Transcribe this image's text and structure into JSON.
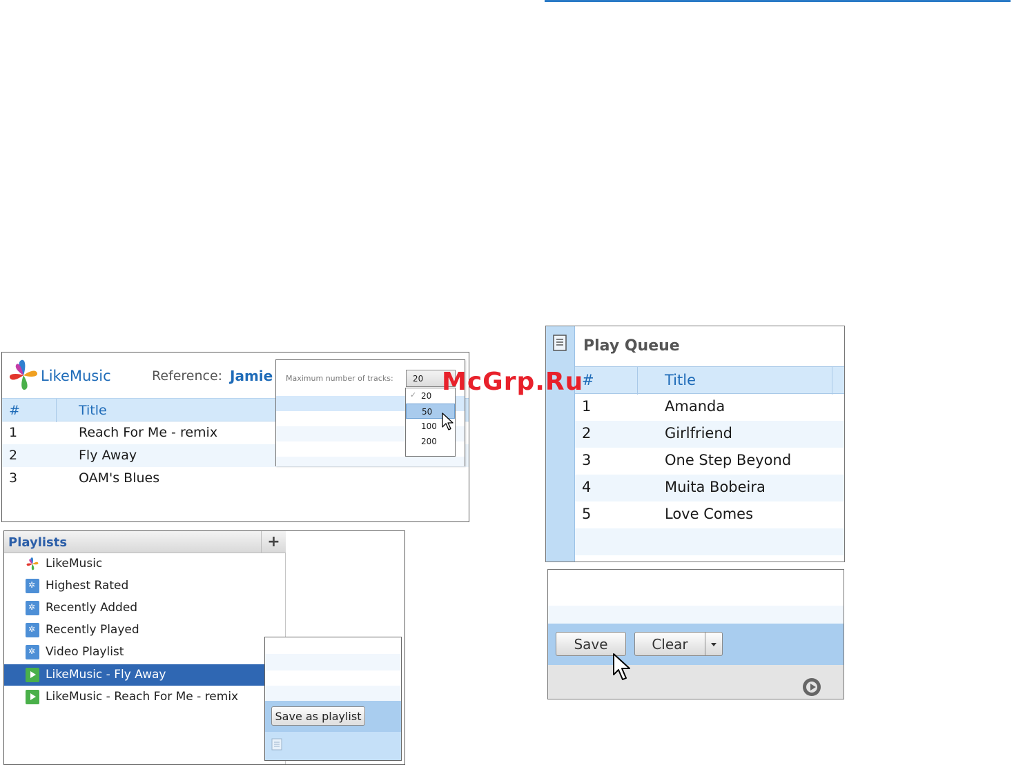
{
  "watermark": "McGrp.Ru",
  "likemusic": {
    "brand": "LikeMusic",
    "reference_label": "Reference:",
    "reference_value": "Jamie",
    "columns": [
      "#",
      "Title"
    ],
    "rows": [
      {
        "num": "1",
        "title": "Reach For Me - remix"
      },
      {
        "num": "2",
        "title": "Fly Away"
      },
      {
        "num": "3",
        "title": "OAM's Blues"
      }
    ],
    "max_tracks": {
      "label": "Maximum number of tracks:",
      "selected": "20",
      "options": [
        "20",
        "50",
        "100",
        "200"
      ],
      "highlighted": "50"
    }
  },
  "playlists": {
    "title": "Playlists",
    "add_label": "+",
    "items": [
      {
        "label": "LikeMusic",
        "icon": "likemusic-logo-icon"
      },
      {
        "label": "Highest Rated",
        "icon": "smart-playlist-icon"
      },
      {
        "label": "Recently Added",
        "icon": "smart-playlist-icon"
      },
      {
        "label": "Recently Played",
        "icon": "smart-playlist-icon"
      },
      {
        "label": "Video Playlist",
        "icon": "smart-playlist-icon"
      },
      {
        "label": "LikeMusic - Fly Away",
        "icon": "playlist-icon",
        "selected": true
      },
      {
        "label": "LikeMusic - Reach For Me - remix",
        "icon": "playlist-icon"
      }
    ],
    "save_as_playlist": "Save as playlist"
  },
  "play_queue": {
    "title": "Play Queue",
    "columns": [
      "#",
      "Title"
    ],
    "rows": [
      {
        "num": "1",
        "title": "Amanda"
      },
      {
        "num": "2",
        "title": "Girlfriend"
      },
      {
        "num": "3",
        "title": "One Step Beyond"
      },
      {
        "num": "4",
        "title": "Muita Bobeira"
      },
      {
        "num": "5",
        "title": "Love Comes"
      }
    ],
    "save_label": "Save",
    "clear_label": "Clear"
  },
  "colors": {
    "accent": "#1e6bb8",
    "header_bg": "#d3e8fa",
    "selected_row": "#2f67b3",
    "watermark": "#e8212b"
  }
}
